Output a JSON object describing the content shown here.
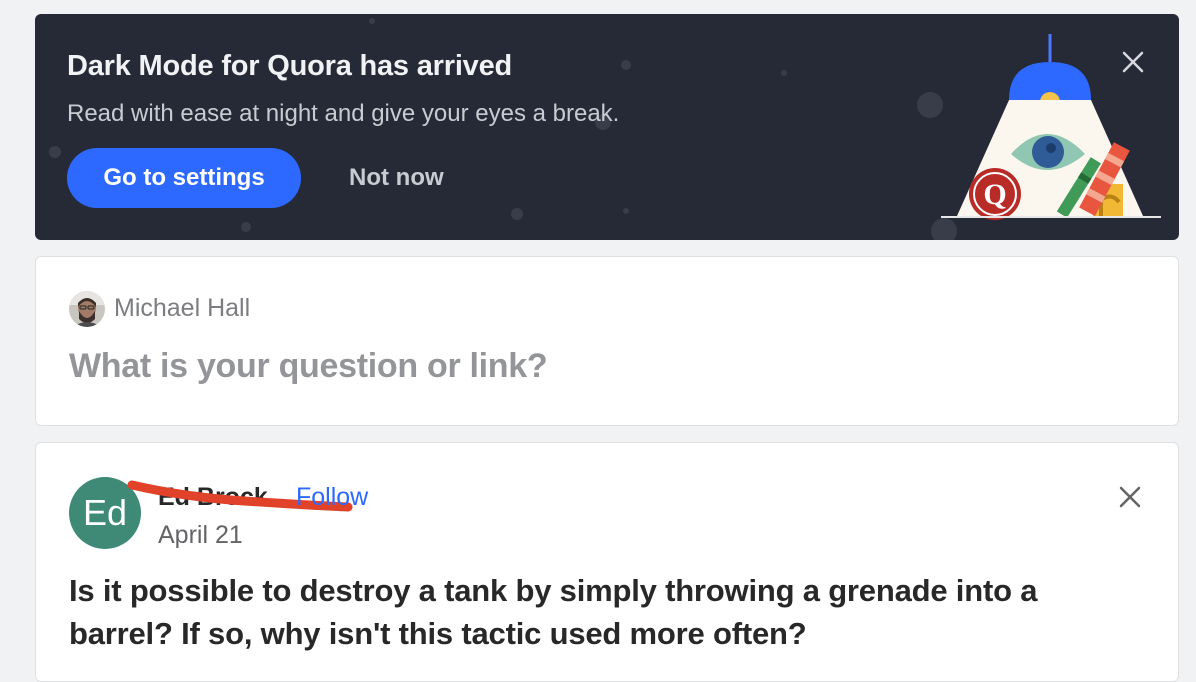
{
  "banner": {
    "title": "Dark Mode for Quora has arrived",
    "subtitle": "Read with ease at night and give your eyes a break.",
    "primary_button": "Go to settings",
    "secondary_button": "Not now",
    "close_icon": "close-icon",
    "illustration_letter": "Q",
    "colors": {
      "background": "#262a37",
      "primary_button": "#2e69ff",
      "logo_red": "#b92b27"
    }
  },
  "ask_box": {
    "user_name": "Michael Hall",
    "prompt": "What is your question or link?"
  },
  "post": {
    "avatar_initials": "Ed",
    "author_name": "Ed Brock",
    "follow_label": "Follow",
    "date": "April 21",
    "close_icon": "close-icon",
    "title": "Is it possible to destroy a tank by simply throwing a grenade into a barrel? If so, why isn't this tactic used more often?",
    "colors": {
      "avatar": "#3e8a77",
      "follow_link": "#2e69ff",
      "redaction_mark": "#e0432a"
    }
  }
}
